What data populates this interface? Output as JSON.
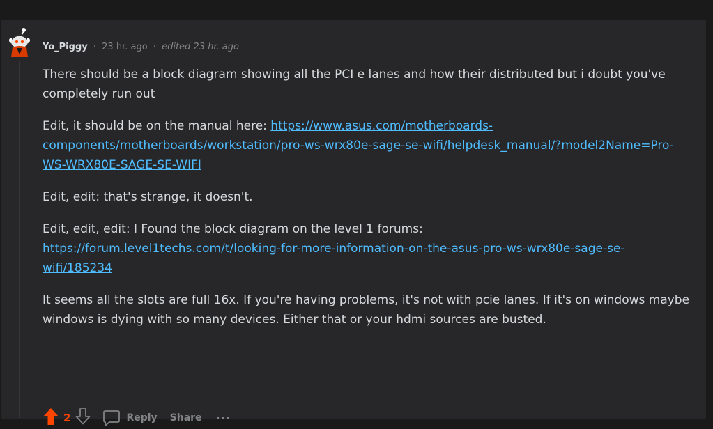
{
  "comment": {
    "author": "Yo_Piggy",
    "separator": "·",
    "timestamp": "23 hr. ago",
    "edited_label": "edited 23 hr. ago",
    "paragraphs": {
      "p1": "There should be a block diagram showing all the PCI e lanes and how their distributed but i doubt you've completely run out",
      "p2_text": "Edit, it should be on the manual here: ",
      "p2_link": "https://www.asus.com/motherboards-components/motherboards/workstation/pro-ws-wrx80e-sage-se-wifi/helpdesk_manual/?model2Name=Pro-WS-WRX80E-SAGE-SE-WIFI",
      "p3": "Edit, edit: that's strange, it doesn't.",
      "p4_text": "Edit, edit, edit: I Found the block diagram on the level 1 forums:",
      "p4_link": "https://forum.level1techs.com/t/looking-for-more-information-on-the-asus-pro-ws-wrx80e-sage-se-wifi/185234",
      "p5": "It seems all the slots are full 16x. If you're having problems, it's not with pcie lanes. If it's on windows maybe windows is dying with so many devices. Either that or your hdmi sources are busted."
    }
  },
  "actions": {
    "score": "2",
    "reply_label": "Reply",
    "share_label": "Share",
    "more_label": "···"
  },
  "icons": {
    "upvote": "upvote-arrow-icon",
    "downvote": "downvote-arrow-icon",
    "reply": "speech-bubble-icon",
    "avatar": "snoo-avatar-icon"
  },
  "colors": {
    "background": "#1a1a1b",
    "card": "#272729",
    "text": "#d7dadc",
    "muted": "#818384",
    "link": "#4fbcff",
    "upvote_active": "#ff4500"
  }
}
